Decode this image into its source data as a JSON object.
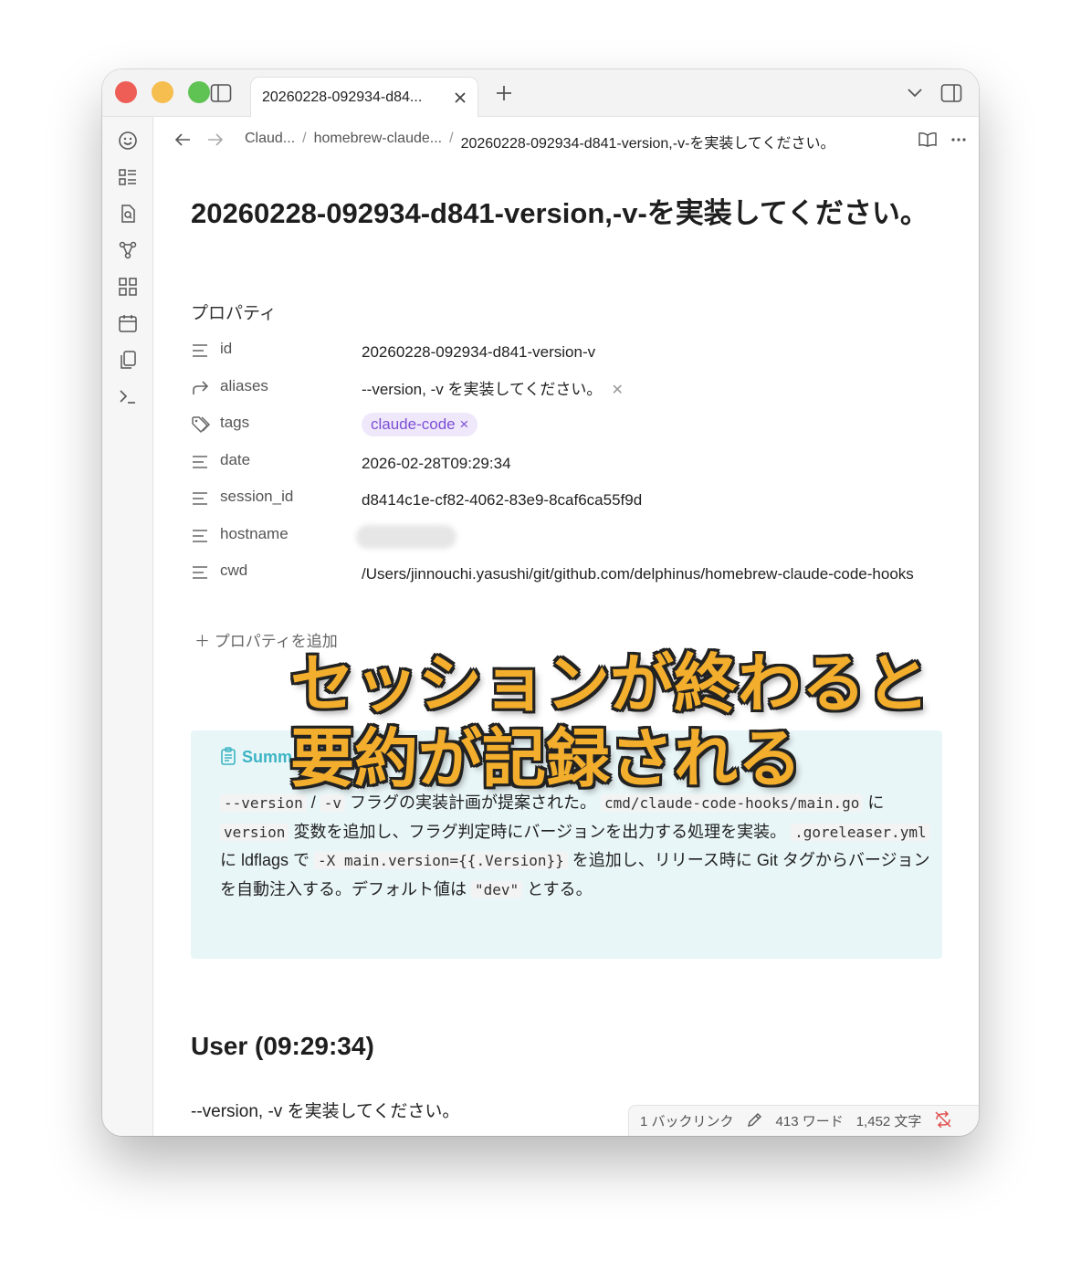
{
  "tab": {
    "title": "20260228-092934-d84..."
  },
  "breadcrumb": {
    "items": [
      "Claud...",
      "homebrew-claude...",
      "20260228-092934-d841-version,-v-を実装してください。"
    ],
    "separator": "/"
  },
  "doc": {
    "title": "20260228-092934-d841-version,-v-を実装してください。"
  },
  "properties": {
    "heading": "プロパティ",
    "items": [
      {
        "key": "id",
        "value": "20260228-092934-d841-version-v"
      },
      {
        "key": "aliases",
        "value": "--version, -v を実装してください。"
      },
      {
        "key": "tags",
        "value": "claude-code ×"
      },
      {
        "key": "date",
        "value": "2026-02-28T09:29:34"
      },
      {
        "key": "session_id",
        "value": "d8414c1e-cf82-4062-83e9-8caf6ca55f9d"
      },
      {
        "key": "hostname",
        "value": ""
      },
      {
        "key": "cwd",
        "value": "/Users/jinnouchi.yasushi/git/github.com/delphinus/homebrew-claude-code-hooks"
      }
    ],
    "add_label": "プロパティを追加"
  },
  "callout": {
    "title": "Summ",
    "parts": {
      "p1": "--version",
      "p2": " / ",
      "p3": "-v",
      "p4": " フラグの実装計画が提案された。",
      "p5": "cmd/claude-code-hooks/main.go",
      "p6": " に ",
      "p7": "version",
      "p8": " 変数を追加し、フラグ判定時にバージョンを出力する処理を実装。",
      "p9": ".goreleaser.yml",
      "p10": " に ldflags で ",
      "p11": "-X main.version={{.Version}}",
      "p12": " を追加し、リリース時に Git タグからバージョンを自動注入する。デフォルト値は ",
      "p13": "\"dev\"",
      "p14": " とする。"
    }
  },
  "user_section": {
    "heading": "User (09:29:34)",
    "text": "--version, -v を実装してください。"
  },
  "statusbar": {
    "backlinks": "1 バックリンク",
    "words": "413 ワード",
    "chars": "1,452 文字"
  },
  "overlay": {
    "line1": "セッションが終わると",
    "line2": "要約が記録される"
  },
  "colors": {
    "tag_bg": "#efe8fb",
    "tag_text": "#7c4fd4",
    "callout_bg": "#e9f6f8",
    "callout_accent": "#3cb4c4",
    "overlay_text": "#f2ae2c"
  }
}
